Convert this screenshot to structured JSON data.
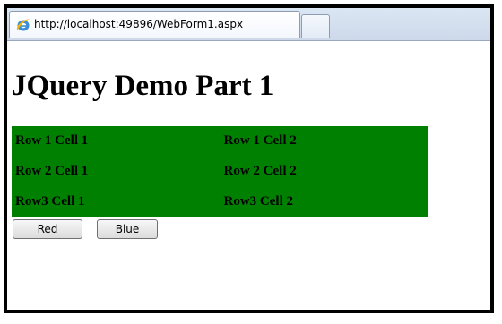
{
  "browser": {
    "tab_title": "http://localhost:49896/WebForm1.aspx",
    "tab_icon": "ie-icon",
    "new_tab_icon": "new-tab-icon"
  },
  "page": {
    "title": "JQuery Demo Part 1",
    "table": {
      "background_color": "#008000",
      "rows": [
        [
          "Row 1 Cell 1",
          "Row 1 Cell 2"
        ],
        [
          "Row 2 Cell 1",
          "Row 2 Cell 2"
        ],
        [
          "Row3 Cell 1",
          "Row3 Cell 2"
        ]
      ]
    },
    "buttons": {
      "red_label": "Red",
      "blue_label": "Blue"
    }
  }
}
